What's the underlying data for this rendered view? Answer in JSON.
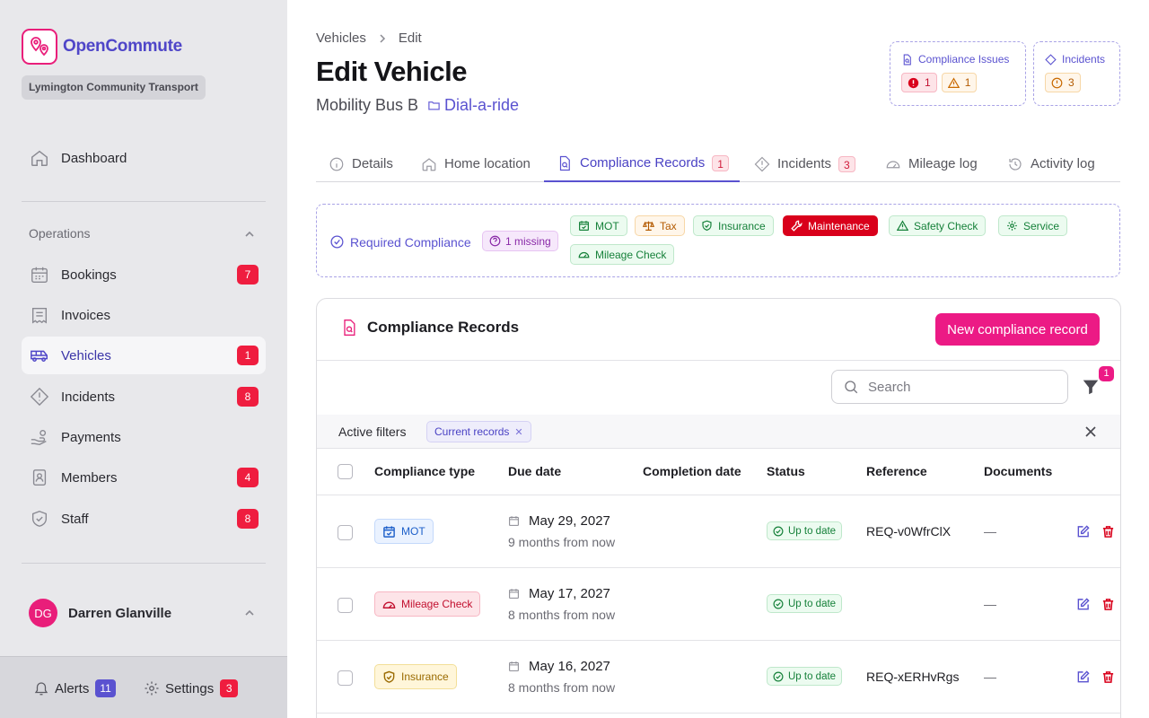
{
  "app": {
    "name": "OpenCommute",
    "org": "Lymington Community Transport"
  },
  "nav": {
    "dashboard": "Dashboard",
    "section": "Operations",
    "items": [
      {
        "label": "Bookings",
        "badge": "7"
      },
      {
        "label": "Invoices",
        "badge": ""
      },
      {
        "label": "Vehicles",
        "badge": "1"
      },
      {
        "label": "Incidents",
        "badge": "8"
      },
      {
        "label": "Payments",
        "badge": ""
      },
      {
        "label": "Members",
        "badge": "4"
      },
      {
        "label": "Staff",
        "badge": "8"
      }
    ]
  },
  "user": {
    "initials": "DG",
    "name": "Darren Glanville"
  },
  "footer": {
    "alerts_label": "Alerts",
    "alerts_count": "11",
    "settings_label": "Settings",
    "settings_count": "3"
  },
  "breadcrumb": {
    "parent": "Vehicles",
    "current": "Edit"
  },
  "page": {
    "title": "Edit Vehicle",
    "vehicle_name": "Mobility Bus B",
    "category": "Dial-a-ride"
  },
  "summary": {
    "compliance_title": "Compliance Issues",
    "compliance_errors": "1",
    "compliance_warnings": "1",
    "incidents_title": "Incidents",
    "incidents_count": "3"
  },
  "tabs": [
    {
      "label": "Details",
      "badge": ""
    },
    {
      "label": "Home location",
      "badge": ""
    },
    {
      "label": "Compliance Records",
      "badge": "1"
    },
    {
      "label": "Incidents",
      "badge": "3"
    },
    {
      "label": "Mileage log",
      "badge": ""
    },
    {
      "label": "Activity log",
      "badge": ""
    }
  ],
  "required": {
    "label": "Required Compliance",
    "missing": "1 missing",
    "tags": [
      "MOT",
      "Tax",
      "Insurance",
      "Maintenance",
      "Safety Check",
      "Service",
      "Mileage Check"
    ]
  },
  "records": {
    "title": "Compliance Records",
    "new_button": "New compliance record",
    "search_placeholder": "Search",
    "filter_count": "1",
    "active_filters_label": "Active filters",
    "active_filter_chip": "Current records",
    "columns": [
      "Compliance type",
      "Due date",
      "Completion date",
      "Status",
      "Reference",
      "Documents"
    ],
    "rows": [
      {
        "type": "MOT",
        "due": "May 29, 2027",
        "relative": "9 months from now",
        "status": "Up to date",
        "reference": "REQ-v0WfrClX",
        "documents": "—"
      },
      {
        "type": "Mileage Check",
        "due": "May 17, 2027",
        "relative": "8 months from now",
        "status": "Up to date",
        "reference": "",
        "documents": "—"
      },
      {
        "type": "Insurance",
        "due": "May 16, 2027",
        "relative": "8 months from now",
        "status": "Up to date",
        "reference": "REQ-xERHvRgs",
        "documents": "—"
      }
    ]
  },
  "colors": {
    "brand": "#ec1a85",
    "accent": "#5a52d0",
    "danger": "#d9001b",
    "success": "#16813a"
  }
}
